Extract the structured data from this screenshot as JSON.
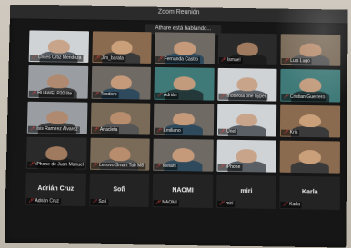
{
  "window": {
    "title": "Zoom Reunión"
  },
  "speaking_banner": "Athare está hablando...",
  "participants": [
    {
      "name": "Ulises Ortiz Mendoza",
      "muted": true,
      "scene": "light"
    },
    {
      "name": "Jim_barata",
      "muted": true,
      "scene": "warm"
    },
    {
      "name": "Fernanda Castro",
      "muted": true,
      "scene": "face"
    },
    {
      "name": "Ismael",
      "muted": true,
      "scene": "dark"
    },
    {
      "name": "Luis Lugo",
      "muted": true,
      "scene": "room"
    },
    {
      "name": "HUAWEI P20 lite",
      "muted": true,
      "scene": "gray"
    },
    {
      "name": "Teodoro",
      "muted": true,
      "scene": "face"
    },
    {
      "name": "Adrián",
      "muted": true,
      "scene": "teal"
    },
    {
      "name": "motorola one hyper",
      "muted": true,
      "scene": "light"
    },
    {
      "name": "Cristian Guerrero",
      "muted": true,
      "scene": "teal"
    },
    {
      "name": "Isis Ramirez Alvarez",
      "muted": true,
      "scene": "gray"
    },
    {
      "name": "Anacleta",
      "muted": true,
      "scene": "room"
    },
    {
      "name": "Emiliano",
      "muted": true,
      "scene": "face"
    },
    {
      "name": "Uriel",
      "muted": true,
      "scene": "light"
    },
    {
      "name": "Kris",
      "muted": true,
      "scene": "warm"
    },
    {
      "name": "iPhone de Juan Manuel",
      "muted": true,
      "scene": "dark"
    },
    {
      "name": "Lenovo Smart Tab M8",
      "muted": true,
      "scene": "room"
    },
    {
      "name": "Melani",
      "muted": true,
      "scene": "face"
    },
    {
      "name": "iPhone",
      "muted": true,
      "scene": "light"
    },
    {
      "name": "",
      "muted": false,
      "scene": "warm"
    }
  ],
  "no_video": [
    {
      "display": "Adrián Cruz",
      "tag": "Adrián Cruz"
    },
    {
      "display": "Sofi",
      "tag": "Sofi"
    },
    {
      "display": "NAOMI",
      "tag": "NAOMI"
    },
    {
      "display": "miri",
      "tag": "miri"
    },
    {
      "display": "Karla",
      "tag": "Karla"
    }
  ],
  "colors": {
    "muted_mic": "#e64545",
    "tile_bg": "#1f1f1f"
  }
}
